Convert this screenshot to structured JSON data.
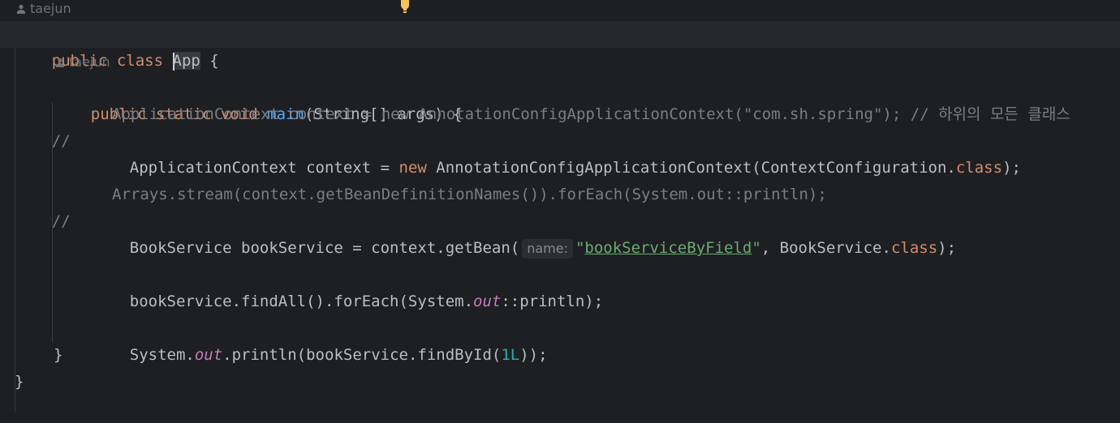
{
  "author": "taejun",
  "lines": {
    "class_decl": {
      "kw_public": "public",
      "kw_class": "class",
      "class_name": "App",
      "brace": " {"
    },
    "main_decl": {
      "kw_public": "public",
      "kw_static": "static",
      "kw_void": "void",
      "method": "main",
      "params": "(String[] args) {"
    },
    "comment1": {
      "prefix": "//",
      "text": "ApplicationContext context = new AnnotationConfigApplicationContext(\"com.sh.spring\"); // 하위의 모든 클래스"
    },
    "context_line": {
      "part1": "ApplicationContext context = ",
      "kw_new": "new",
      "part2": " AnnotationConfigApplicationContext(ContextConfiguration.",
      "kw_class": "class",
      "part3": ");"
    },
    "comment2": {
      "prefix": "//",
      "text": "Arrays.stream(context.getBeanDefinitionNames()).forEach(System.out::println);"
    },
    "getbean_line": {
      "part1": "BookService bookService = context.getBean(",
      "hint": "name:",
      "str_q1": "\"",
      "str_val": "bookServiceByField",
      "str_q2": "\"",
      "part2": ", BookService.",
      "kw_class": "class",
      "part3": ");"
    },
    "findall_line": {
      "part1": "bookService.findAll().forEach(System.",
      "field": "out",
      "part2": "::println);"
    },
    "println_line": {
      "part1": "System.",
      "field": "out",
      "part2": ".println(bookService.findById(",
      "num": "1L",
      "part3": "));"
    },
    "close_method": "}",
    "close_class": "}"
  },
  "colors": {
    "background": "#1e1f22",
    "keyword": "#cf8e6d",
    "function": "#56a8f5",
    "string": "#6aab73",
    "static_field": "#c77dbb",
    "number": "#2aacb8",
    "comment": "#7a7e85",
    "bulb": "#f2c55c"
  },
  "icons": [
    "person-icon",
    "lightbulb-icon"
  ]
}
